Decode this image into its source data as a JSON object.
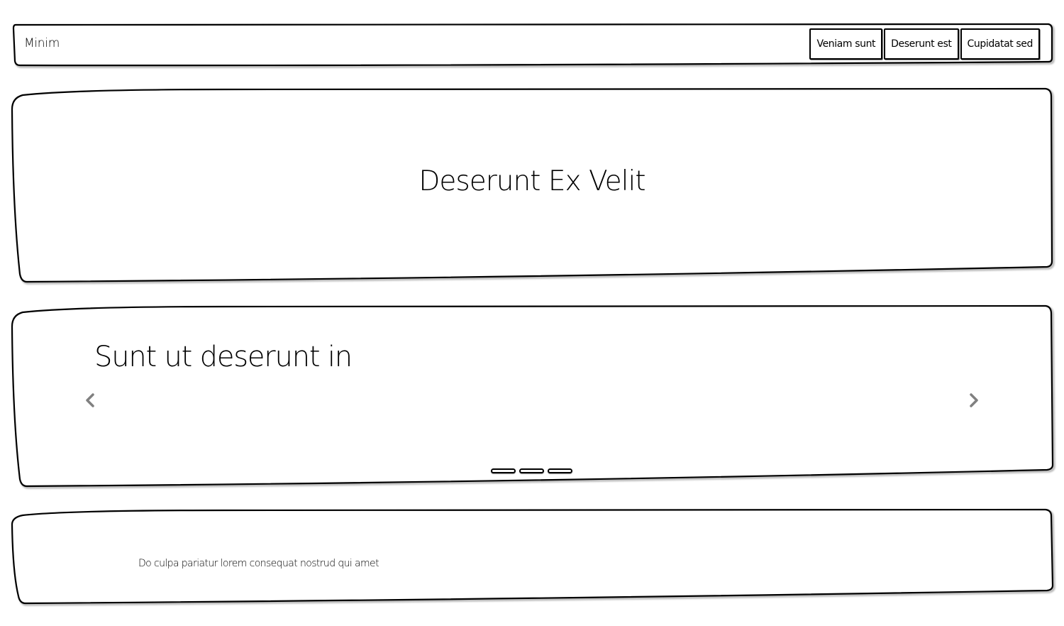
{
  "header": {
    "brand": "Minim",
    "nav": [
      {
        "label": "Veniam sunt"
      },
      {
        "label": "Deserunt est"
      },
      {
        "label": "Cupidatat sed"
      }
    ]
  },
  "hero": {
    "title": "Deserunt Ex Velit"
  },
  "carousel": {
    "slide_title": "Sunt ut deserunt in",
    "prev_icon": "chevron-left-icon",
    "next_icon": "chevron-right-icon",
    "indicator_count": 3,
    "arrow_color": "#808080"
  },
  "footer": {
    "text": "Do culpa pariatur lorem consequat nostrud qui amet"
  }
}
